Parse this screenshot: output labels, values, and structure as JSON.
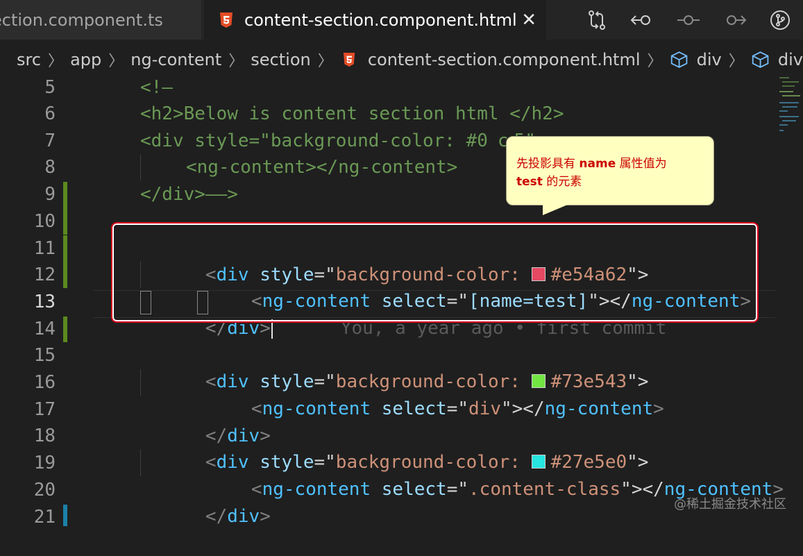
{
  "tabs": {
    "inactive_label": "ection.component.ts",
    "active_label": "content-section.component.html",
    "close_glyph": "✕"
  },
  "tab_actions": [
    "compare-changes-icon",
    "go-back-icon",
    "timeline-icon",
    "go-forward-icon",
    "source-control-icon"
  ],
  "breadcrumb": {
    "items": [
      "src",
      "app",
      "ng-content",
      "section",
      "content-section.component.html",
      "div",
      "div"
    ]
  },
  "editor": {
    "line_numbers": [
      "5",
      "6",
      "7",
      "8",
      "9",
      "10",
      "11",
      "12",
      "13",
      "14",
      "15",
      "16",
      "17",
      "18",
      "19",
      "20",
      "21"
    ],
    "line5": "<!—",
    "line6": "<h2>Below is content section html </h2>",
    "line7a": "<div style=\"background-color: #0",
    "line7b": "c",
    "line7c": "5\"",
    "line8": "<ng-content></ng-content>",
    "line9": "</div>——>",
    "line11": {
      "open": "<",
      "tag": "div",
      "attr": "style",
      "eq": "=\"",
      "val": "background-color: ",
      "color": "#e54a62",
      "close": "\">"
    },
    "line12": {
      "open": "<",
      "tag": "ng-content",
      "attr": "select",
      "eq": "=\"",
      "val": "[name=test]",
      "close": "\"></",
      "tag2": "ng-content",
      "end": ">"
    },
    "line13": {
      "open": "</",
      "tag": "div",
      "end": ">",
      "blame": "You, a year ago • first commit"
    },
    "line15": {
      "open": "<",
      "tag": "div",
      "attr": "style",
      "eq": "=\"",
      "val": "background-color: ",
      "color": "#73e543",
      "close": "\">"
    },
    "line16": {
      "open": "<",
      "tag": "ng-content",
      "attr": "select",
      "eq": "=\"",
      "val": "div",
      "close": "\"></",
      "tag2": "ng-content",
      "end": ">"
    },
    "line17": {
      "open": "</",
      "tag": "div",
      "end": ">"
    },
    "line18": {
      "open": "<",
      "tag": "div",
      "attr": "style",
      "eq": "=\"",
      "val": "background-color: ",
      "color": "#27e5e0",
      "close": "\">"
    },
    "line19": {
      "open": "<",
      "tag": "ng-content",
      "attr": "select",
      "eq": "=\"",
      "val": ".content-class",
      "close": "\"></",
      "tag2": "ng-content",
      "end": ">"
    },
    "line20": {
      "open": "</",
      "tag": "div",
      "end": ">"
    }
  },
  "callout": {
    "prefix": "先投影具有 ",
    "keyword1": "name",
    "middle": " 属性值为",
    "keyword2": "test",
    "suffix": " 的元素"
  },
  "watermark": "@稀土掘金技术社区",
  "colors": {
    "highlight": "#d9001b",
    "callout_bg": "#ffffc0",
    "callout_text": "#cc0000",
    "git_modified": "#5b8a1e",
    "git_added": "#1b81a8"
  }
}
